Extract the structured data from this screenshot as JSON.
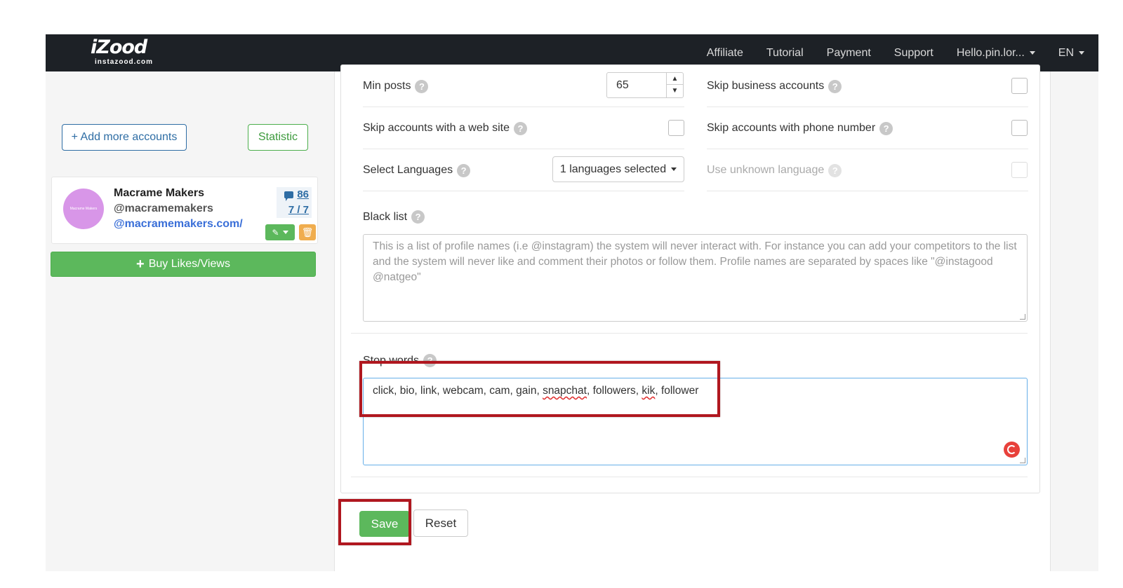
{
  "navbar": {
    "logo_text": "iZood",
    "logo_sub": "instazood.com",
    "links": [
      "Affiliate",
      "Tutorial",
      "Payment",
      "Support"
    ],
    "user_menu": "Hello.pin.lor...",
    "language": "EN"
  },
  "sidebar": {
    "add_accounts": "+ Add more accounts",
    "statistic": "Statistic",
    "account": {
      "avatar_text": "Macrame Makers",
      "name": "Macrame Makers",
      "handle": "@macramemakers",
      "link": "@macramemakers.com/",
      "comments": "86",
      "ratio": "7 / 7"
    },
    "buy_button": "Buy Likes/Views"
  },
  "settings": {
    "min_posts_label": "Min posts",
    "min_posts_value": "65",
    "skip_business_label": "Skip business accounts",
    "skip_website_label": "Skip accounts with a web site",
    "skip_phone_label": "Skip accounts with phone number",
    "select_languages_label": "Select Languages",
    "languages_value": "1 languages selected",
    "unknown_language_label": "Use unknown language",
    "blacklist_label": "Black list",
    "blacklist_placeholder": "This is a list of profile names (i.e @instagram) the system will never interact with. For instance you can add your competitors to the list and the system will never like and comment their photos or follow them. Profile names are separated by spaces like \"@instagood @natgeo\"",
    "stop_words_label": "Stop words",
    "stop_words": {
      "part1": "click, bio, link, webcam, cam, gain, ",
      "word1": "snapchat",
      "part2": ", followers, ",
      "word2": "kik",
      "part3": ", follower"
    }
  },
  "actions": {
    "save": "Save",
    "reset": "Reset"
  },
  "colors": {
    "navbar": "#1d2126",
    "success": "#5cb85c",
    "primary": "#2e6da4",
    "highlight": "#b0171f"
  }
}
